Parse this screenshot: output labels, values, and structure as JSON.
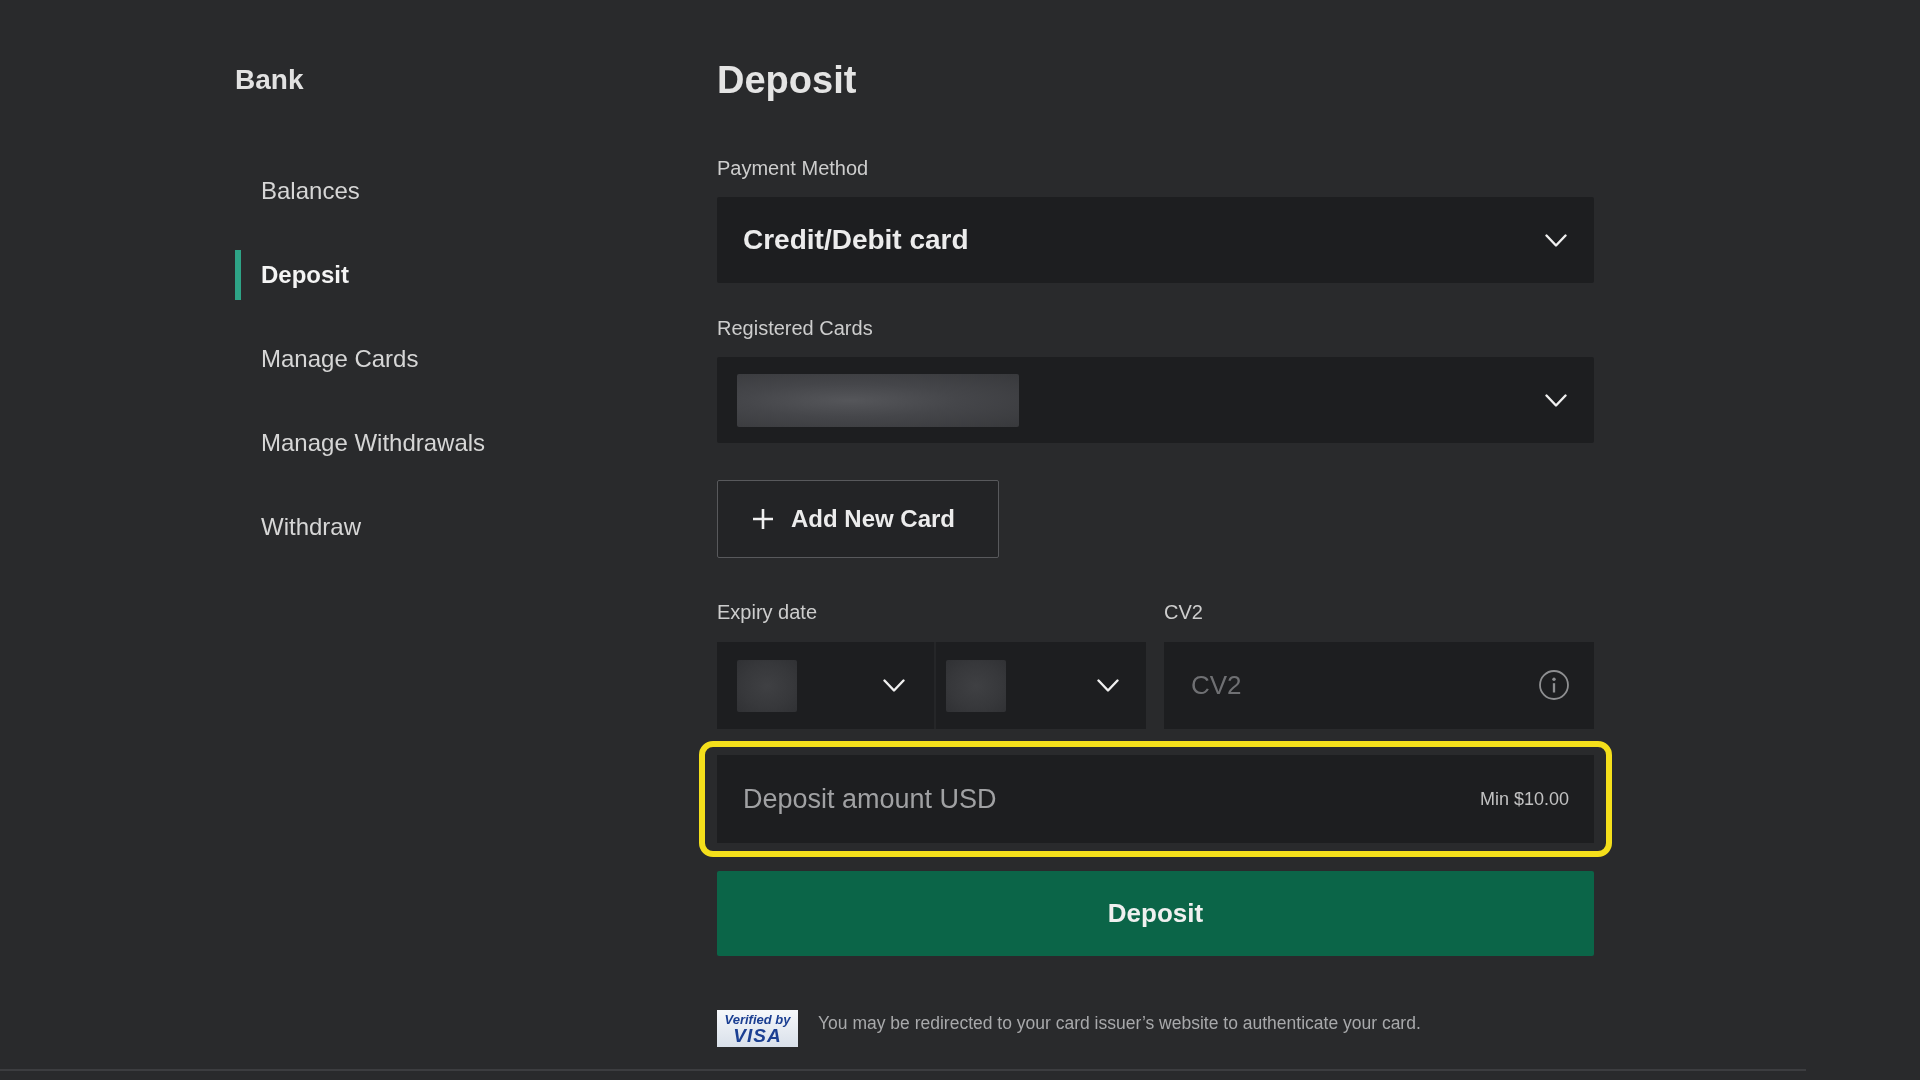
{
  "sidebar": {
    "title": "Bank",
    "items": [
      {
        "label": "Balances",
        "selected": false
      },
      {
        "label": "Deposit",
        "selected": true
      },
      {
        "label": "Manage Cards",
        "selected": false
      },
      {
        "label": "Manage Withdrawals",
        "selected": false
      },
      {
        "label": "Withdraw",
        "selected": false
      }
    ]
  },
  "main": {
    "title": "Deposit",
    "payment_method": {
      "label": "Payment Method",
      "value": "Credit/Debit card"
    },
    "registered_cards": {
      "label": "Registered Cards",
      "value_hidden": true
    },
    "add_card_button": {
      "label": "Add New Card"
    },
    "expiry_date": {
      "label": "Expiry date",
      "selects": [
        {
          "value_hidden": true
        },
        {
          "value_hidden": true
        }
      ]
    },
    "cv2": {
      "label": "CV2",
      "placeholder": "CV2"
    },
    "deposit_amount": {
      "placeholder": "Deposit amount USD",
      "minimum": "Min $10.00",
      "highlighted": true
    },
    "submit_button": {
      "label": "Deposit"
    },
    "notice": {
      "logo_line_1": "Verified by",
      "logo_line_2": "VISA",
      "text": "You may be redirected to your card issuer’s website to authenticate your card."
    }
  }
}
